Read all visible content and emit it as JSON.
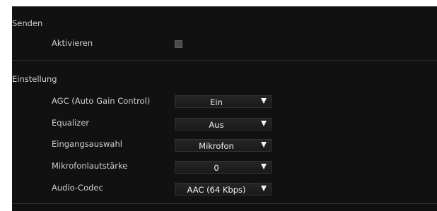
{
  "send_section": {
    "title": "Senden",
    "enable_label": "Aktivieren",
    "enable_checked": false
  },
  "settings_section": {
    "title": "Einstellung",
    "rows": [
      {
        "label": "AGC (Auto Gain Control)",
        "value": "Ein"
      },
      {
        "label": "Equalizer",
        "value": "Aus"
      },
      {
        "label": "Eingangsauswahl",
        "value": "Mikrofon"
      },
      {
        "label": "Mikrofonlautstärke",
        "value": "0"
      },
      {
        "label": "Audio-Codec",
        "value": "AAC (64 Kbps)"
      }
    ]
  },
  "colors": {
    "panel_background": "#111111",
    "text": "#d2d2d2",
    "select_text": "#f2f2f2",
    "checkbox_fill": "#4a4a4a"
  },
  "icons": {
    "select_arrow": "triangle-down-icon"
  }
}
